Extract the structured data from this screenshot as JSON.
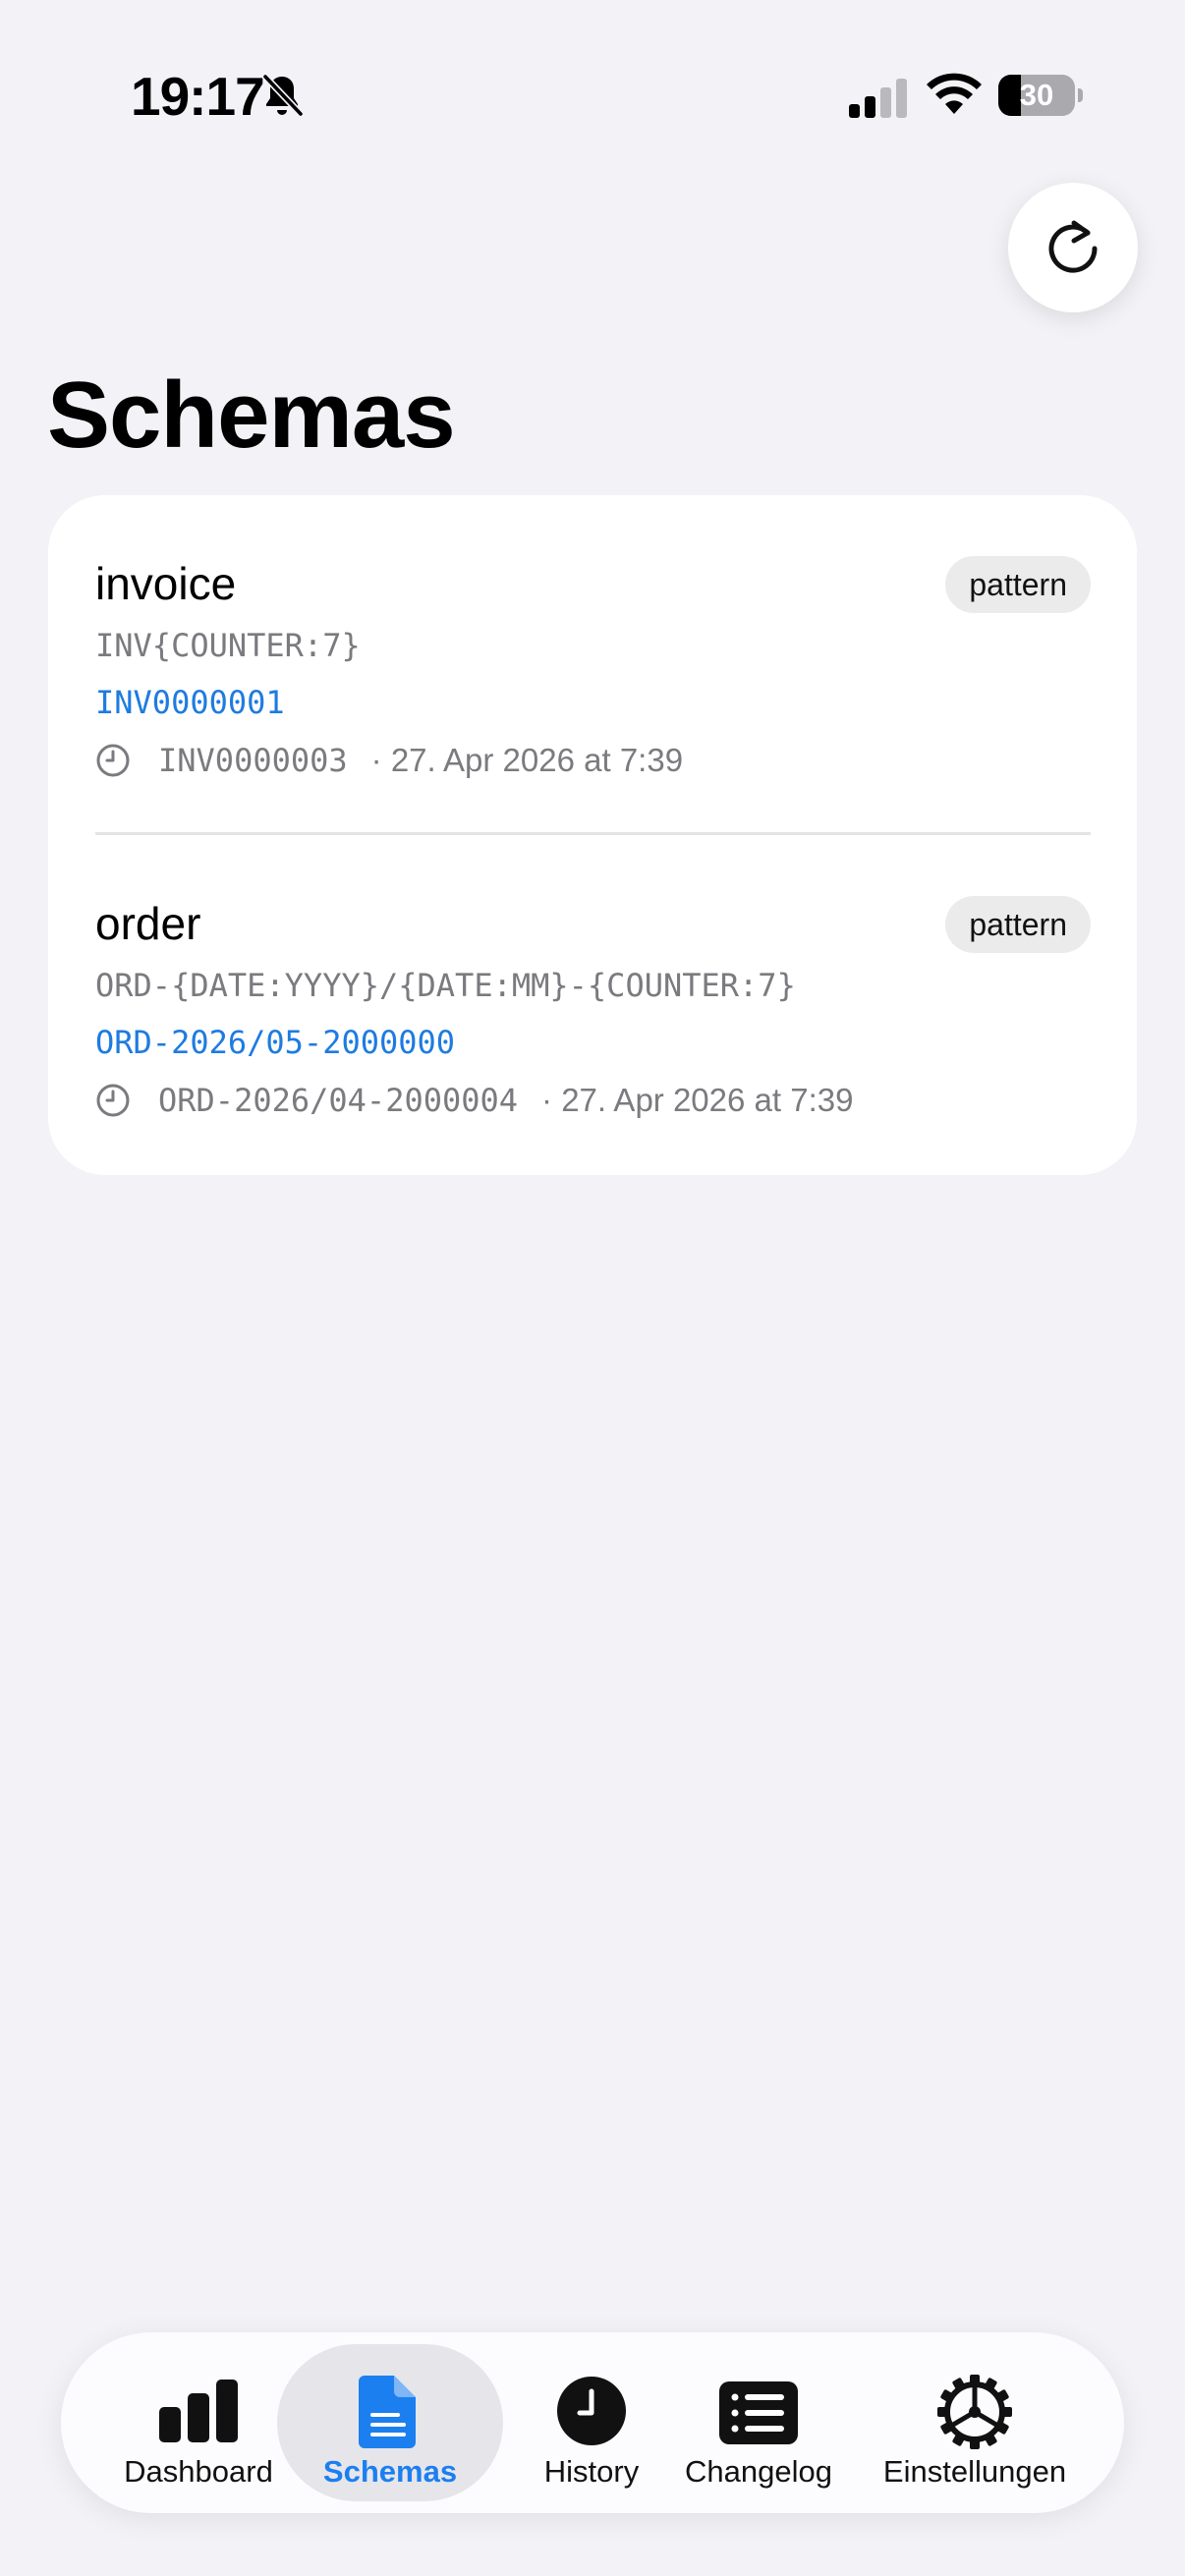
{
  "status_bar": {
    "time": "19:17",
    "battery_level": 30,
    "battery_text": "30",
    "icons": [
      "bell-slash-icon",
      "cellular-signal-icon",
      "wifi-icon",
      "battery-icon"
    ]
  },
  "header": {
    "refresh_icon": "refresh-icon",
    "title": "Schemas"
  },
  "schemas": [
    {
      "name": "invoice",
      "badge": "pattern",
      "pattern": "INV{COUNTER:7}",
      "next_value": "INV0000001",
      "last_value": "INV0000003",
      "last_date": "· 27. Apr 2026 at 7:39"
    },
    {
      "name": "order",
      "badge": "pattern",
      "pattern": "ORD-{DATE:YYYY}/{DATE:MM}-{COUNTER:7}",
      "next_value": "ORD-2026/05-2000000",
      "last_value": "ORD-2026/04-2000004",
      "last_date": "· 27. Apr 2026 at 7:39"
    }
  ],
  "tab_bar": {
    "active": "schemas",
    "tabs": [
      {
        "id": "dashboard",
        "label": "Dashboard",
        "icon": "chart-bar-icon"
      },
      {
        "id": "schemas",
        "label": "Schemas",
        "icon": "document-icon"
      },
      {
        "id": "history",
        "label": "History",
        "icon": "clock-icon"
      },
      {
        "id": "changelog",
        "label": "Changelog",
        "icon": "list-icon"
      },
      {
        "id": "settings",
        "label": "Einstellungen",
        "icon": "gear-icon"
      }
    ]
  },
  "colors": {
    "background": "#f2f2f7",
    "accent": "#1c7ff0",
    "secondary_text": "#7a7a7f"
  }
}
